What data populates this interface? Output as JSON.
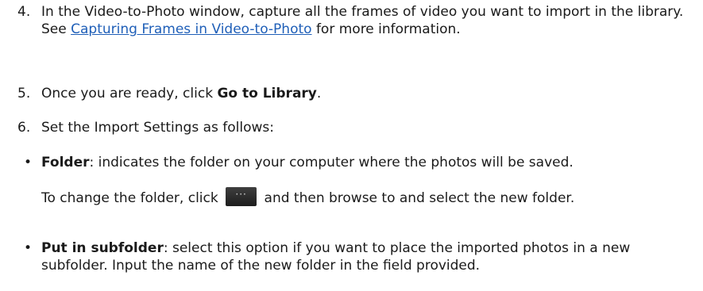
{
  "steps": [
    {
      "number": "4.",
      "text_before_link": "In the Video-to-Photo window, capture all the frames of video you want to import in the library. See ",
      "link_text": "Capturing Frames in Video-to-Photo",
      "text_after_link": " for more information."
    },
    {
      "number": "5.",
      "text_before": "Once you are ready, click ",
      "bold": "Go to Library",
      "text_after": "."
    },
    {
      "number": "6.",
      "text": "Set the Import Settings as follows:"
    }
  ],
  "bullets": [
    {
      "marker": "•",
      "term": "Folder",
      "text": ": indicates the folder on your computer where the photos will be saved.",
      "extra_before": "To change the folder, click ",
      "extra_after": " and then browse to and select the new folder.",
      "button_icon": "ellipsis-icon"
    },
    {
      "marker": "•",
      "term": "Put in subfolder",
      "text": ": select this option if you want to place the imported photos in a new subfolder. Input the name of the new folder in the field provided."
    }
  ]
}
